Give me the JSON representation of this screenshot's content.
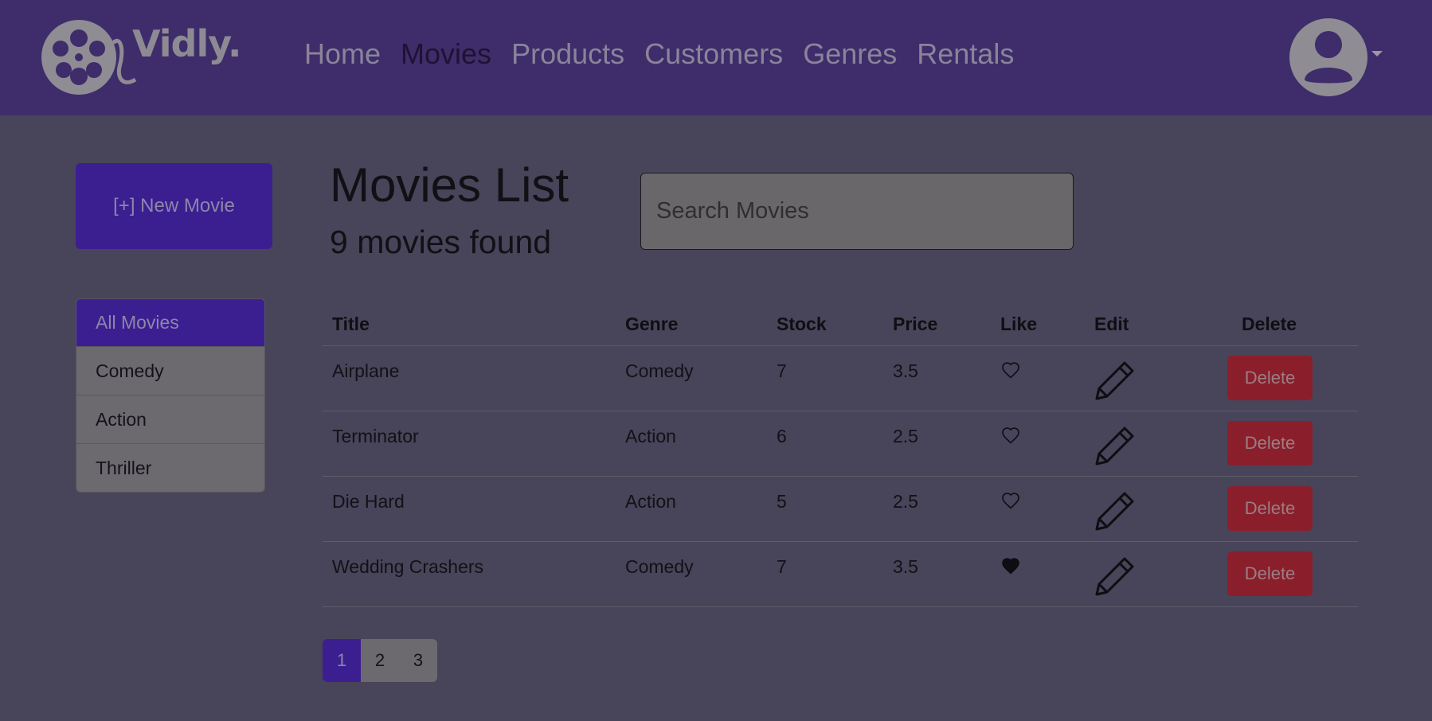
{
  "navbar": {
    "brand": "Vidly.",
    "links": [
      {
        "label": "Home",
        "active": false
      },
      {
        "label": "Movies",
        "active": true
      },
      {
        "label": "Products",
        "active": false
      },
      {
        "label": "Customers",
        "active": false
      },
      {
        "label": "Genres",
        "active": false
      },
      {
        "label": "Rentals",
        "active": false
      }
    ],
    "avatar_icon": "user-circle-icon"
  },
  "sidebar": {
    "new_movie_label": "[+] New Movie",
    "genres": [
      {
        "label": "All Movies",
        "active": true
      },
      {
        "label": "Comedy",
        "active": false
      },
      {
        "label": "Action",
        "active": false
      },
      {
        "label": "Thriller",
        "active": false
      }
    ]
  },
  "main": {
    "title": "Movies List",
    "count_text": "9 movies found",
    "search_placeholder": "Search Movies",
    "columns": [
      "Title",
      "Genre",
      "Stock",
      "Price",
      "Like",
      "Edit",
      "Delete"
    ],
    "rows": [
      {
        "title": "Airplane",
        "genre": "Comedy",
        "stock": "7",
        "price": "3.5",
        "liked": false,
        "delete_label": "Delete"
      },
      {
        "title": "Terminator",
        "genre": "Action",
        "stock": "6",
        "price": "2.5",
        "liked": false,
        "delete_label": "Delete"
      },
      {
        "title": "Die Hard",
        "genre": "Action",
        "stock": "5",
        "price": "2.5",
        "liked": false,
        "delete_label": "Delete"
      },
      {
        "title": "Wedding Crashers",
        "genre": "Comedy",
        "stock": "7",
        "price": "3.5",
        "liked": true,
        "delete_label": "Delete"
      }
    ],
    "pagination": [
      {
        "label": "1",
        "active": true
      },
      {
        "label": "2",
        "active": false
      },
      {
        "label": "3",
        "active": false
      }
    ]
  },
  "colors": {
    "navbar_bg": "#3e2d6a",
    "page_bg": "#484459",
    "primary": "#3b1f91",
    "danger": "#8a1f2b"
  }
}
